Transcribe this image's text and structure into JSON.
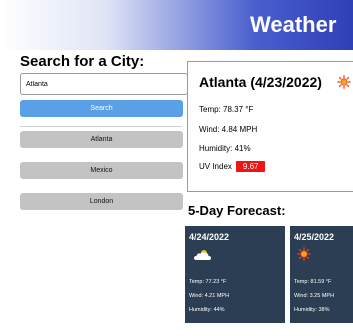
{
  "header": {
    "title": "Weather"
  },
  "search": {
    "heading": "Search for a City:",
    "input_value": "Atlanta",
    "button_label": "Search"
  },
  "history": [
    "Atlanta",
    "Mexico",
    "London"
  ],
  "current": {
    "title": "Atlanta (4/23/2022)",
    "icon": "sun-icon",
    "temp": "Temp: 78.37 °F",
    "wind": "Wind: 4.84 MPH",
    "humidity": "Humidity: 41%",
    "uv_label": "UV Index",
    "uv_value": "9.67",
    "uv_color": "#f01515"
  },
  "forecast": {
    "heading": "5-Day Forecast:",
    "card_color": "#2c3e54",
    "days": [
      {
        "date": "4/24/2022",
        "icon": "cloudy-icon",
        "temp": "Temp: 77.23 °F",
        "wind": "Wind: 4.21 MPH",
        "humidity": "Humidity: 44%"
      },
      {
        "date": "4/25/2022",
        "icon": "sun-icon",
        "temp": "Temp: 81.59 °F",
        "wind": "Wind: 3.25 MPH",
        "humidity": "Humidity: 38%"
      }
    ]
  }
}
